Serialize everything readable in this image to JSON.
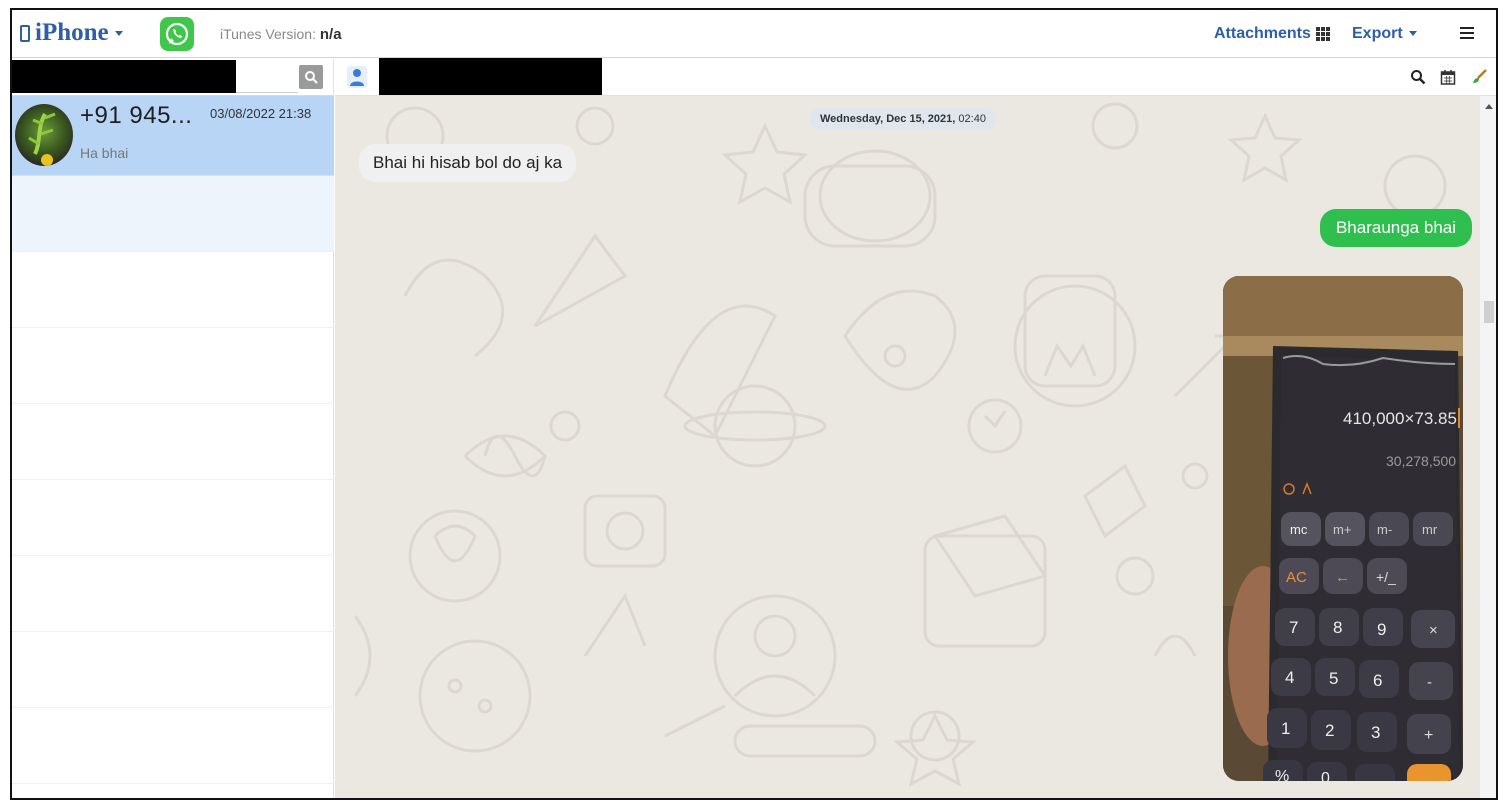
{
  "header": {
    "device_label": "iPhone",
    "itunes_label": "iTunes Version:",
    "itunes_value": "n/a",
    "attachments_label": "Attachments",
    "export_label": "Export"
  },
  "contact_list": {
    "items": [
      {
        "name": "+91 945...",
        "date": "03/08/2022 21:38",
        "last_message": "Ha bhai"
      }
    ]
  },
  "chat": {
    "date_separator_day": "Wednesday, Dec 15, 2021,",
    "date_separator_time": "02:40",
    "messages": [
      {
        "direction": "incoming",
        "text": "Bhai hi hisab bol do aj ka"
      },
      {
        "direction": "outgoing",
        "text": "Bharaunga bhai"
      }
    ],
    "image_attachment": {
      "calc_expression": "410,000×73.85",
      "calc_result": "30,278,500",
      "keys_row1": [
        "mc",
        "m+",
        "m-",
        "mr"
      ],
      "keys_row2": [
        "AC",
        "←",
        "+/_",
        ""
      ],
      "keys_row3": [
        "7",
        "8",
        "9",
        "×"
      ],
      "keys_row4": [
        "4",
        "5",
        "6",
        "-"
      ],
      "keys_row5": [
        "1",
        "2",
        "3",
        "+"
      ],
      "keys_row6": [
        "%",
        "0",
        "",
        ""
      ]
    }
  },
  "colors": {
    "brand_blue": "#2e5ea8",
    "whatsapp_green": "#3ec74a",
    "selected_row": "#b9d5f6",
    "outgoing_bubble": "#2fbf4f"
  }
}
